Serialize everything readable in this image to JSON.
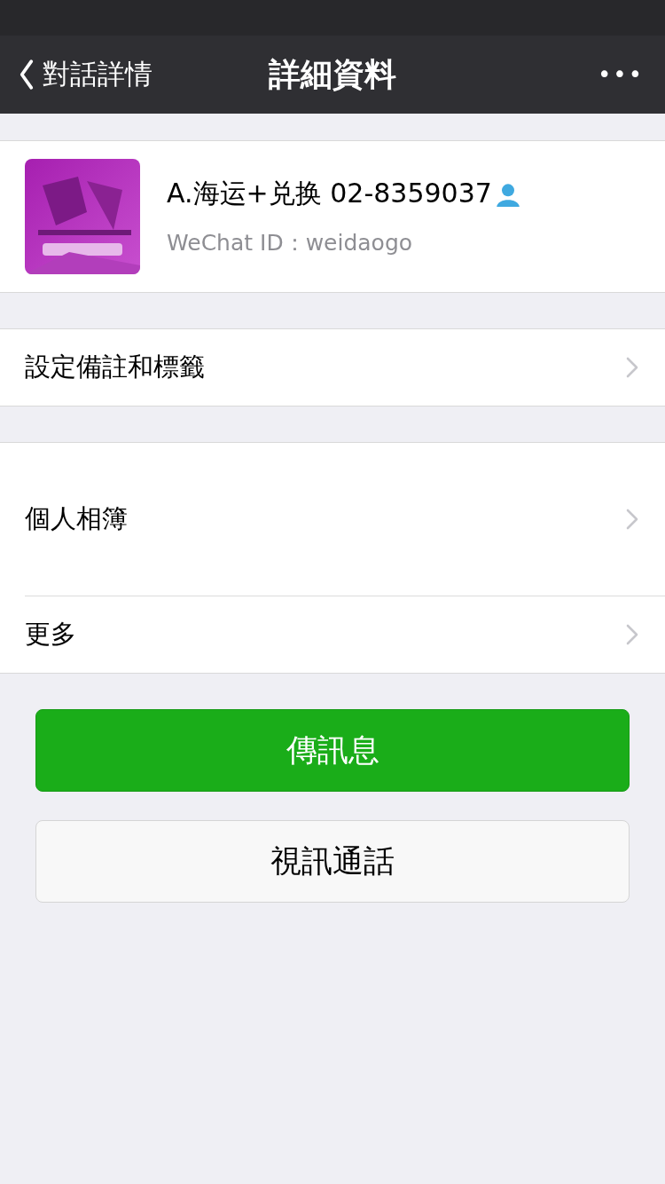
{
  "nav_bar": {
    "back_label": "對話詳情",
    "title": "詳細資料",
    "more": "•••"
  },
  "profile": {
    "name": "A.海运+兑换 02-8359037",
    "wechat_id": "WeChat ID：weidaogo"
  },
  "menu_groups": [
    [
      {
        "kind": "link",
        "label": "設定備註和標籤"
      }
    ],
    [
      {
        "kind": "album",
        "label": "個人相簿"
      },
      {
        "kind": "link",
        "label": "更多"
      }
    ]
  ],
  "buttons": [
    {
      "kind": "primary",
      "label": "傳訊息"
    },
    {
      "kind": "secondary",
      "label": "視訊通話"
    }
  ]
}
